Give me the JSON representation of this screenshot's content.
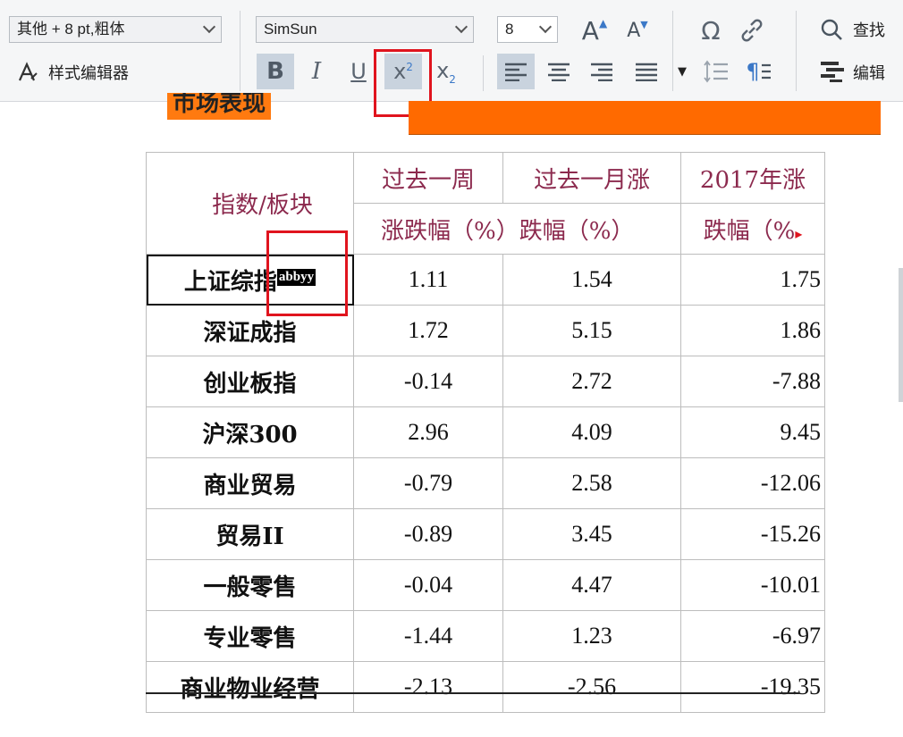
{
  "toolbar": {
    "style_combo": "其他 + 8 pt,粗体",
    "font_combo": "SimSun",
    "size_combo": "8",
    "style_editor_label": "样式编辑器",
    "find_label": "查找",
    "edit_label": "编辑",
    "bold_glyph": "B",
    "italic_glyph": "I",
    "underline_glyph": "U",
    "superscript_glyph": "x",
    "subscript_glyph": "x",
    "omega_glyph": "Ω",
    "pilcrow_glyph": "¶",
    "grow_font_glyph": "A",
    "shrink_font_glyph": "A",
    "accent": "#e0141e"
  },
  "document": {
    "heading": "市场表现",
    "table": {
      "header_col0": "指数/板块",
      "header_row1": [
        "过去一周",
        "过去一月涨",
        "2017年涨"
      ],
      "header_row2": [
        "涨跌幅（%）",
        "跌幅（%）",
        "跌幅（%"
      ],
      "selected_marker": "abbyy",
      "rows": [
        {
          "name": "上证综指",
          "week": "1.11",
          "month": "1.54",
          "ytd": "1.75"
        },
        {
          "name": "深证成指",
          "week": "1.72",
          "month": "5.15",
          "ytd": "1.86"
        },
        {
          "name": "创业板指",
          "week": "-0.14",
          "month": "2.72",
          "ytd": "-7.88"
        },
        {
          "name": "沪深300",
          "week": "2.96",
          "month": "4.09",
          "ytd": "9.45"
        },
        {
          "name": "商业贸易",
          "week": "-0.79",
          "month": "2.58",
          "ytd": "-12.06"
        },
        {
          "name": "贸易II",
          "week": "-0.89",
          "month": "3.45",
          "ytd": "-15.26"
        },
        {
          "name": "一般零售",
          "week": "-0.04",
          "month": "4.47",
          "ytd": "-10.01"
        },
        {
          "name": "专业零售",
          "week": "-1.44",
          "month": "1.23",
          "ytd": "-6.97"
        },
        {
          "name": "商业物业经营",
          "week": "-2.13",
          "month": "-2.56",
          "ytd": "-19.35"
        }
      ]
    }
  }
}
